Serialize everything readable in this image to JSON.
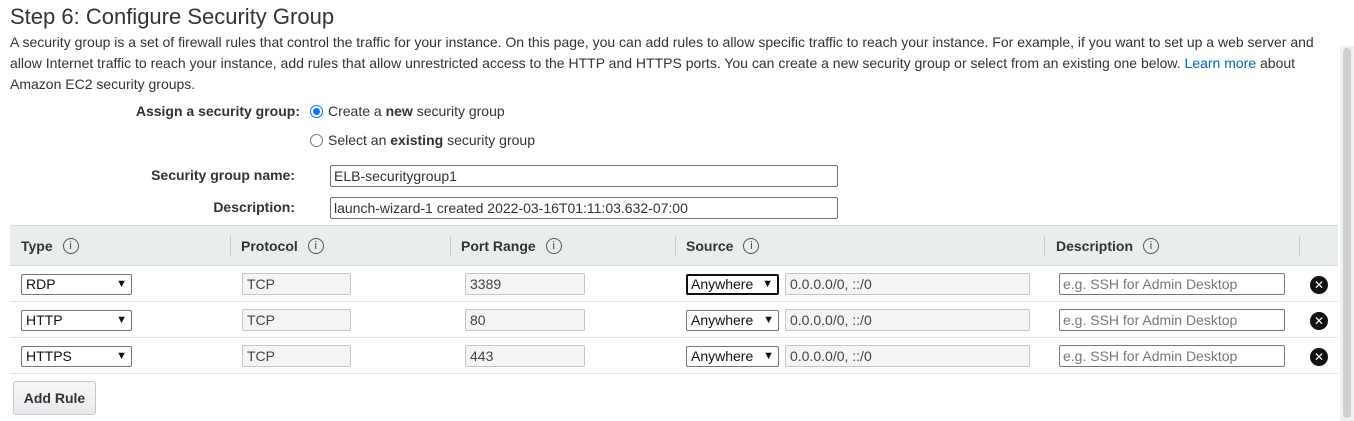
{
  "page": {
    "title": "Step 6: Configure Security Group",
    "intro_text": "A security group is a set of firewall rules that control the traffic for your instance. On this page, you can add rules to allow specific traffic to reach your instance. For example, if you want to set up a web server and allow Internet traffic to reach your instance, add rules that allow unrestricted access to the HTTP and HTTPS ports. You can create a new security group or select from an existing one below.",
    "learn_more_link": "Learn more",
    "intro_suffix": "about Amazon EC2 security groups."
  },
  "assign": {
    "label": "Assign a security group:",
    "option_new_pre": "Create a",
    "option_new_bold": "new",
    "option_new_post": "security group",
    "option_existing_pre": "Select an",
    "option_existing_bold": "existing",
    "option_existing_post": "security group",
    "selected": "new"
  },
  "form": {
    "name_label": "Security group name:",
    "name_value": "ELB-securitygroup1",
    "description_label": "Description:",
    "description_value": "launch-wizard-1 created 2022-03-16T01:11:03.632-07:00"
  },
  "table": {
    "headers": [
      "Type",
      "Protocol",
      "Port Range",
      "Source",
      "Description"
    ],
    "info_icon": "i",
    "rows": [
      {
        "type": "RDP",
        "protocol": "TCP",
        "port": "3389",
        "source": "Anywhere",
        "cidr": "0.0.0.0/0, ::/0",
        "description_placeholder": "e.g. SSH for Admin Desktop"
      },
      {
        "type": "HTTP",
        "protocol": "TCP",
        "port": "80",
        "source": "Anywhere",
        "cidr": "0.0.0.0/0, ::/0",
        "description_placeholder": "e.g. SSH for Admin Desktop"
      },
      {
        "type": "HTTPS",
        "protocol": "TCP",
        "port": "443",
        "source": "Anywhere",
        "cidr": "0.0.0.0/0, ::/0",
        "description_placeholder": "e.g. SSH for Admin Desktop"
      }
    ],
    "remove_icon": "✕"
  },
  "actions": {
    "add_rule_label": "Add Rule"
  },
  "icons": {
    "dropdown": "chevron-down-icon",
    "info": "info-icon",
    "remove": "remove-circle-icon"
  },
  "colors": {
    "link": "#0066c0",
    "header_bg": "#eaeded",
    "radio_accent": "#0075ff"
  }
}
